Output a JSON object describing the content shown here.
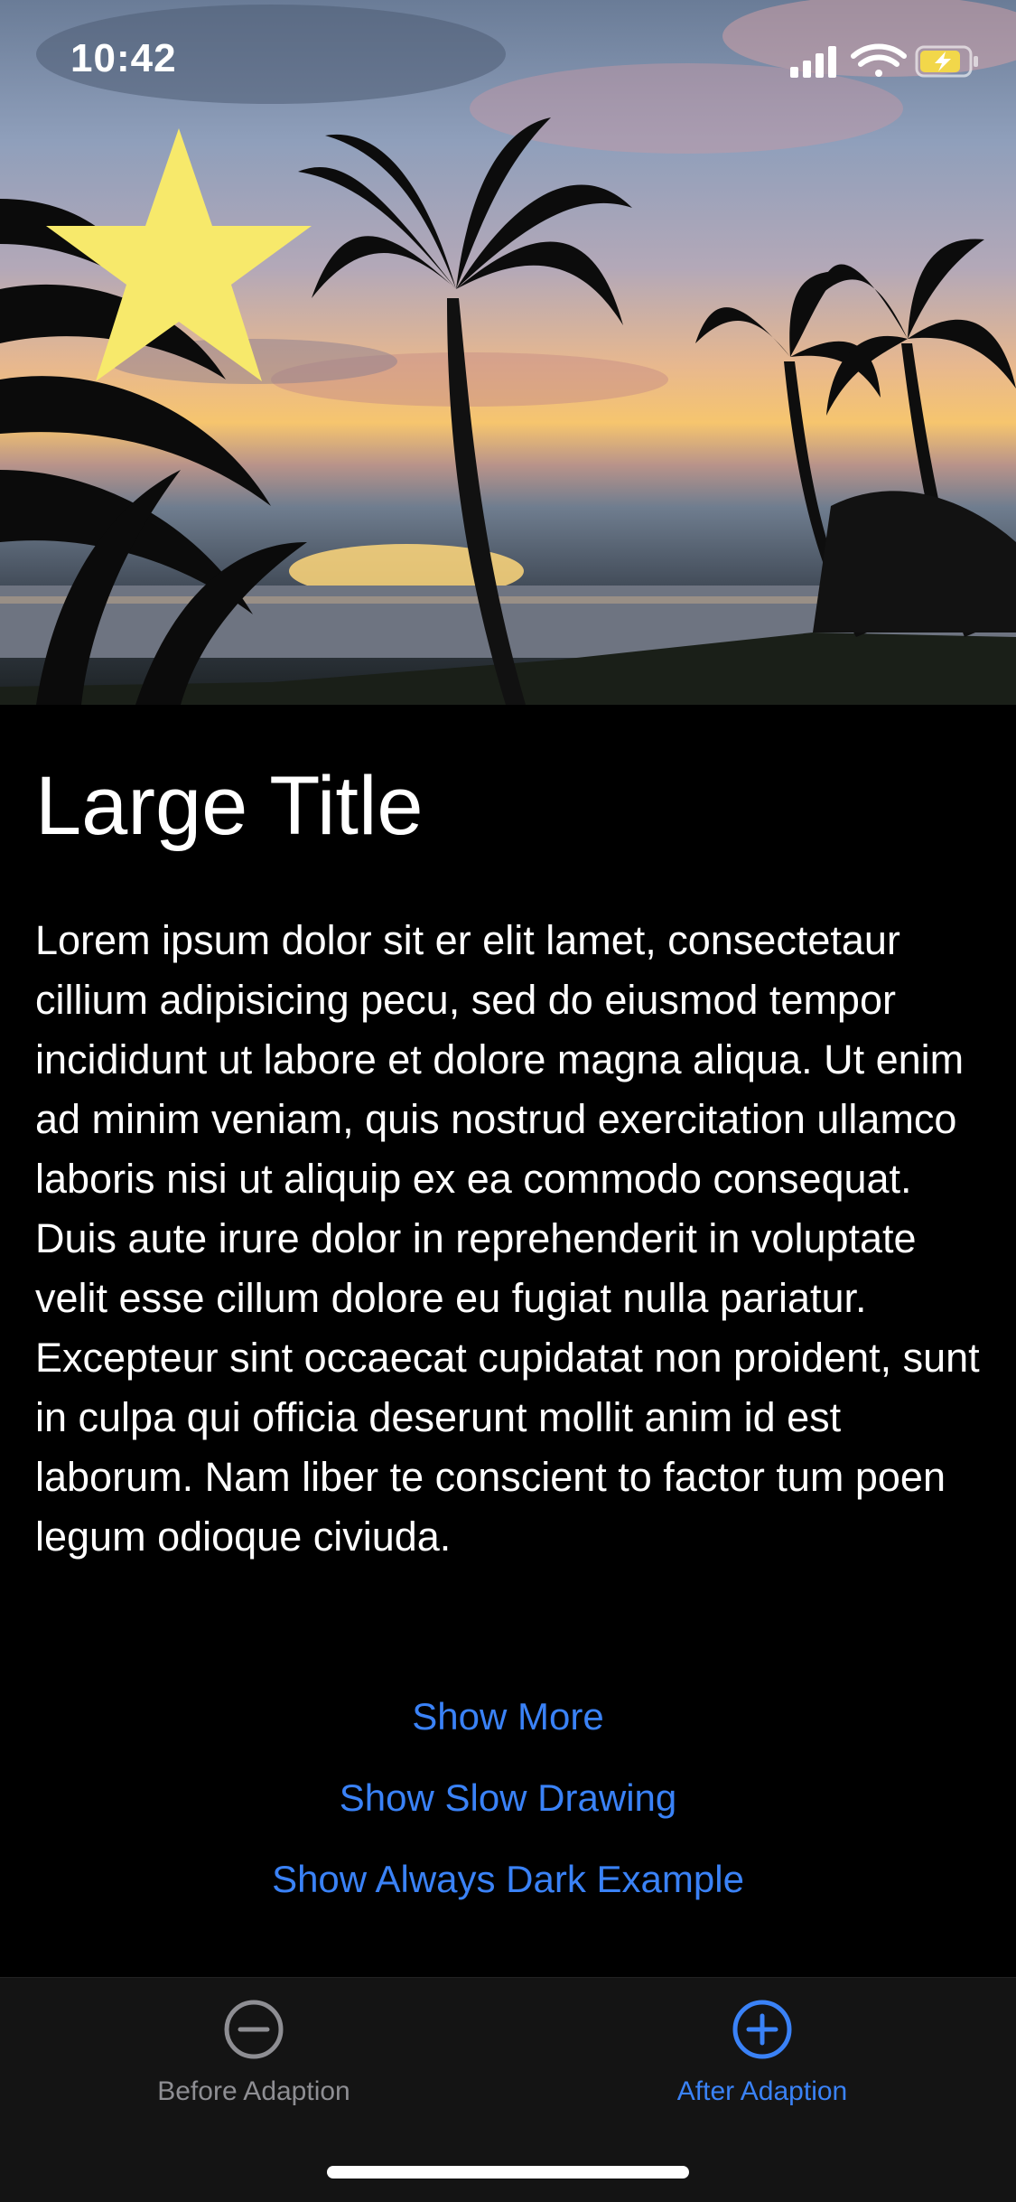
{
  "status_bar": {
    "time": "10:42",
    "icons": [
      "signal-icon",
      "wifi-icon",
      "battery-charging-icon"
    ]
  },
  "hero": {
    "image": "sunset-palm-trees-image",
    "overlay_icon": "star-icon",
    "star_color": "#f7e96b"
  },
  "content": {
    "title": "Large Title",
    "body": "Lorem ipsum dolor sit er elit lamet, consectetaur cillium adipisicing pecu, sed do eiusmod tempor incididunt ut labore et dolore magna aliqua. Ut enim ad minim veniam, quis nostrud exercitation ullamco laboris nisi ut aliquip ex ea commodo consequat. Duis aute irure dolor in reprehenderit in voluptate velit esse cillum dolore eu fugiat nulla pariatur. Excepteur sint occaecat cupidatat non proident, sunt in culpa qui officia deserunt mollit anim id est laborum. Nam liber te conscient to factor tum poen legum odioque civiuda."
  },
  "actions": {
    "show_more": "Show More",
    "show_slow_drawing": "Show Slow Drawing",
    "show_always_dark": "Show Always Dark Example"
  },
  "tab_bar": {
    "tabs": [
      {
        "label": "Before Adaption",
        "icon": "minus-circle-icon",
        "selected": false
      },
      {
        "label": "After Adaption",
        "icon": "plus-circle-icon",
        "selected": true
      }
    ]
  },
  "colors": {
    "accent": "#3a82f7",
    "background": "#000000",
    "tab_bar_background": "#141414",
    "inactive_tab": "#8e8e93"
  }
}
